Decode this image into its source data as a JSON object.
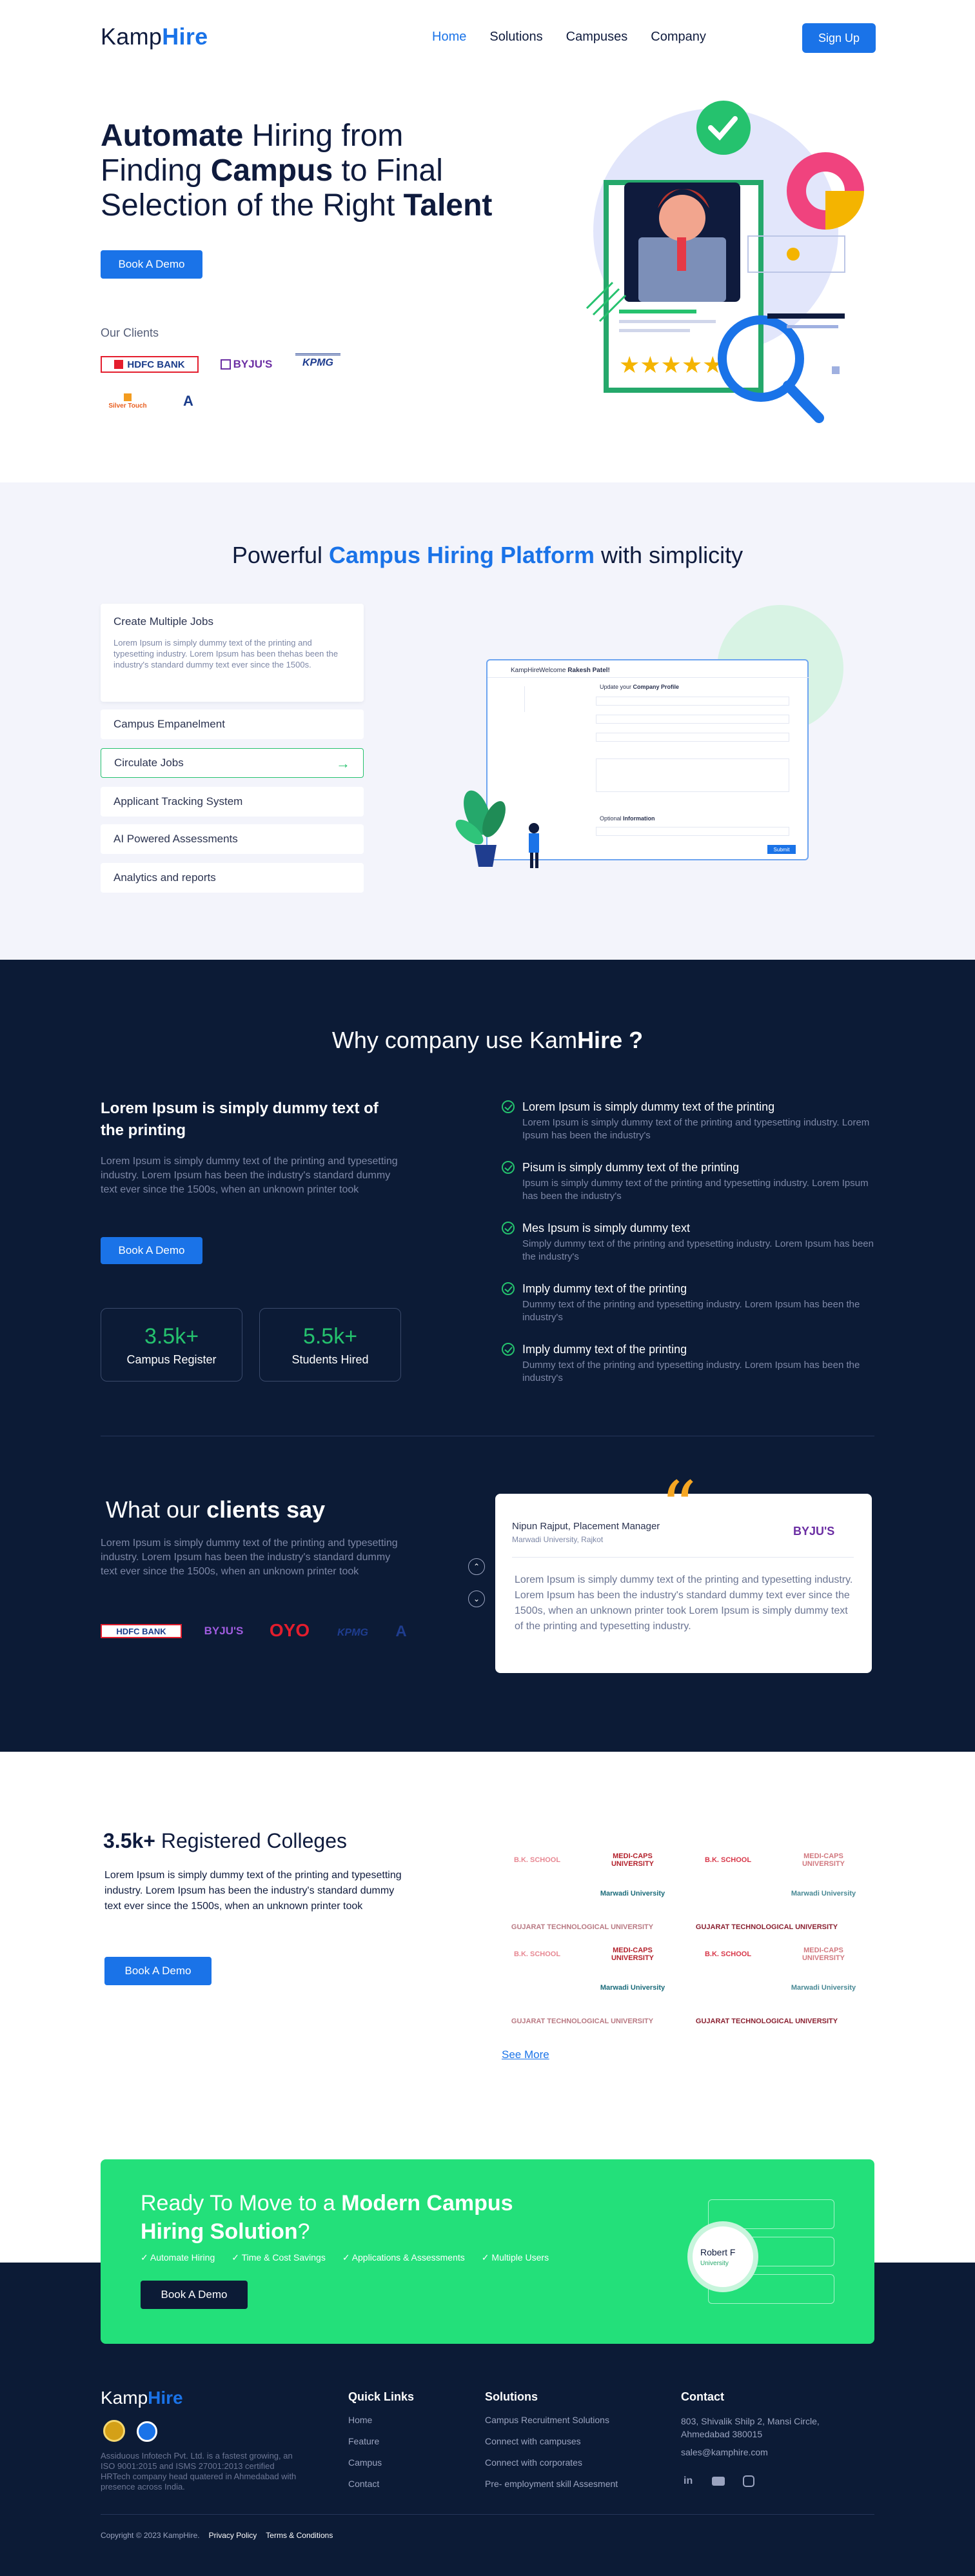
{
  "header": {
    "logo_a": "Kamp",
    "logo_b": "Hire",
    "nav": [
      "Home",
      "Solutions",
      "Campuses",
      "Company"
    ],
    "signup": "Sign Up"
  },
  "hero": {
    "t1b": "Automate",
    "t1": " Hiring from",
    "t2": "Finding ",
    "t2b": "Campus",
    "t2c": " to Final",
    "t3": "Selection of the Right ",
    "t3b": "Talent",
    "cta": "Book A Demo",
    "clients_label": "Our Clients",
    "clients": [
      "HDFC BANK",
      "BYJU'S",
      "KPMG",
      "Silver Touch",
      "A"
    ]
  },
  "platform": {
    "title_a": "Powerful ",
    "title_b": "Campus Hiring Platform",
    "title_c": " with simplicity",
    "card_title": "Create Multiple Jobs",
    "card_text": "Lorem Ipsum is simply dummy text of the printing and typesetting industry. Lorem Ipsum has been thehas been the industry's standard dummy text ever since the 1500s.",
    "items": [
      "Campus Empanelment",
      "Circulate Jobs",
      "Applicant Tracking System",
      "AI Powered Assessments",
      "Analytics and reports"
    ],
    "mock": {
      "logo": "KampHire",
      "welcome": "Welcome ",
      "welcome_name": "Rakesh Patel!",
      "update": "Update your ",
      "update_b": "Company Profile",
      "optional": "Optional ",
      "optional_b": "Information",
      "submit": "Submit"
    }
  },
  "why": {
    "title_a": "Why company use ",
    "title_b": "Kam",
    "title_c": "Hire ?",
    "heading": "Lorem Ipsum is simply dummy text of the printing",
    "text": "Lorem Ipsum is simply dummy text of the printing and typesetting industry. Lorem Ipsum has been the industry's standard dummy text ever since the 1500s, when an unknown printer took",
    "cta": "Book A Demo",
    "stats": [
      {
        "value": "3.5k+",
        "label": "Campus Register"
      },
      {
        "value": "5.5k+",
        "label": "Students Hired"
      }
    ],
    "points": [
      {
        "title": "Lorem Ipsum is simply dummy text of the printing",
        "desc": "Lorem Ipsum is simply dummy text of the printing and typesetting industry. Lorem Ipsum has been the industry's"
      },
      {
        "title": "Pisum is simply dummy text of the printing",
        "desc": "Ipsum is simply dummy text of the printing and typesetting industry. Lorem Ipsum has been the industry's"
      },
      {
        "title": "Mes Ipsum is simply dummy text",
        "desc": "Simply dummy text of the printing and typesetting industry. Lorem Ipsum has been the industry's"
      },
      {
        "title": "Imply dummy text of the printing",
        "desc": "Dummy text of the printing and typesetting industry. Lorem Ipsum has been the industry's"
      },
      {
        "title": "Imply dummy text of the printing",
        "desc": "Dummy text of the printing and typesetting industry. Lorem Ipsum has been the industry's"
      }
    ]
  },
  "clients_say": {
    "title_a": "What our ",
    "title_b": "clients say",
    "text": "Lorem Ipsum is simply dummy text of the printing and typesetting industry. Lorem Ipsum has been the industry's standard dummy text ever since the 1500s, when an unknown printer took",
    "logos": [
      "HDFC BANK",
      "BYJU'S",
      "OYO",
      "KPMG",
      "A"
    ],
    "quote_mark": "“",
    "reviewer": "Nipun Rajput, Placement Manager",
    "org": "Marwadi University, Rajkot",
    "brand": "BYJU'S",
    "review": "Lorem Ipsum is simply dummy text of the printing and typesetting industry. Lorem Ipsum has been the industry's standard dummy text ever since the 1500s, when an unknown printer took Lorem Ipsum is simply dummy text of the printing and typesetting industry."
  },
  "colleges": {
    "count": "3.5k+",
    "title": " Registered Colleges",
    "text": "Lorem Ipsum is simply dummy text of the printing and typesetting industry. Lorem Ipsum has been the industry's standard dummy text ever since the 1500s, when an unknown printer took",
    "cta": "Book A Demo",
    "see_more": "See More",
    "logos": [
      "B.K. SCHOOL",
      "MEDI-CAPS UNIVERSITY",
      "Marwadi University",
      "GUJARAT TECHNOLOGICAL UNIVERSITY"
    ]
  },
  "cta": {
    "t1": "Ready To Move to a ",
    "t1b": "Modern Campus",
    "t2b": "Hiring Solution",
    "t2": "?",
    "features": [
      "Automate Hiring",
      "Time & Cost Savings",
      "Applications & Assessments",
      "Multiple Users"
    ],
    "button": "Book A Demo",
    "card_name": "Robert F",
    "card_sub": "University"
  },
  "footer": {
    "desc": "Assiduous Infotech Pvt. Ltd. is a fastest growing, an ISO 9001:2015 and ISMS 27001:2013 certified HRTech company head quatered in Ahmedabad with presence across India.",
    "quick_title": "Quick Links",
    "quick": [
      "Home",
      "Feature",
      "Campus",
      "Contact"
    ],
    "sol_title": "Solutions",
    "sol": [
      "Campus Recruitment Solutions",
      "Connect with campuses",
      "Connect with corporates",
      "Pre- employment skill Assesment"
    ],
    "contact_title": "Contact",
    "address": "803, Shivalik Shilp 2, Mansi Circle, Ahmedabad 380015",
    "email": "sales@kamphire.com",
    "copyright": "Copyright © 2023 KampHire.",
    "privacy": "Privacy Policy",
    "terms": "Terms & Conditions"
  },
  "colors": {
    "primary": "#1a73e8",
    "green": "#23e07a",
    "dark": "#0c1b36"
  }
}
